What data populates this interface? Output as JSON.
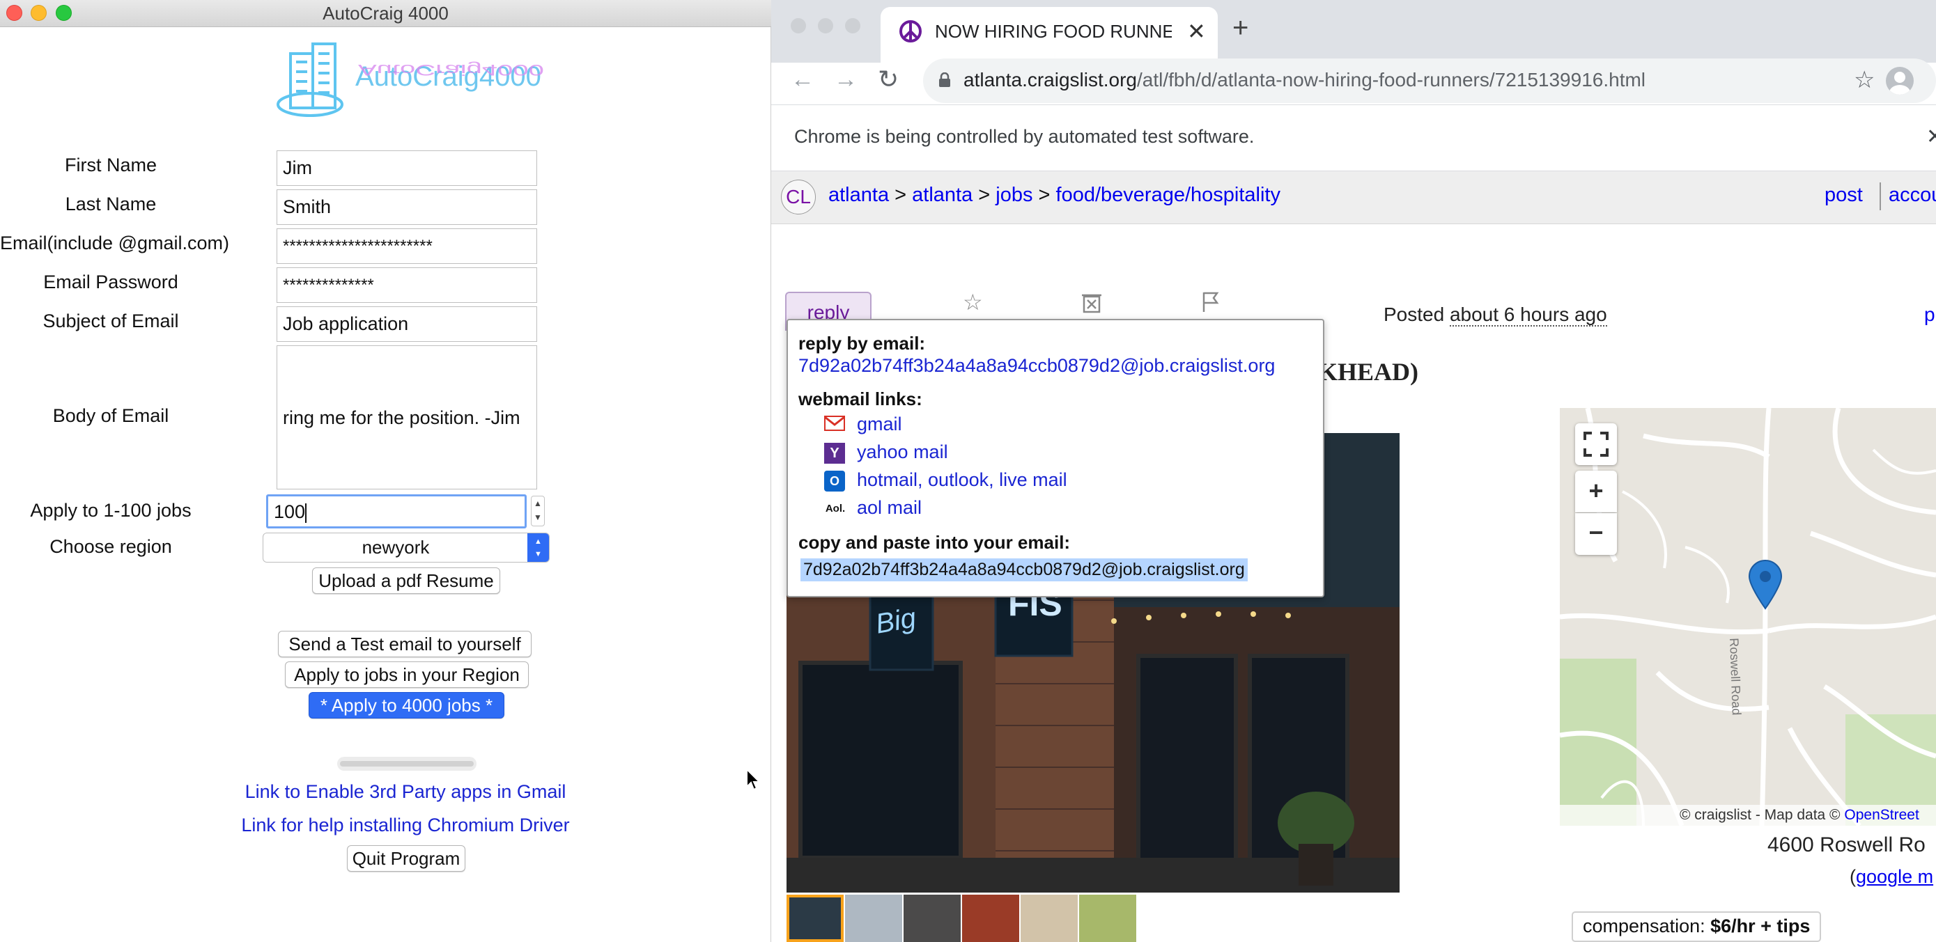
{
  "tk_app": {
    "window_title": "AutoCraig 4000",
    "logo_text": "AutoCraig4000",
    "fields": [
      {
        "label": "First Name",
        "value": "Jim"
      },
      {
        "label": "Last Name",
        "value": "Smith"
      },
      {
        "label": "Email(include @gmail.com)",
        "value": "***********************"
      },
      {
        "label": "Email Password",
        "value": "**************"
      },
      {
        "label": "Subject of Email",
        "value": "Job application"
      },
      {
        "label": "Body of Email",
        "value": "ring me for the position. -Jim"
      }
    ],
    "apply_count_label": "Apply to 1-100 jobs",
    "apply_count_value": "100",
    "region_label": "Choose region",
    "region_value": "newyork",
    "upload_button": "Upload a pdf Resume",
    "test_email_button": "Send a Test email to yourself",
    "apply_region_button": "Apply to jobs in your Region",
    "apply_all_button": "* Apply to 4000 jobs *",
    "progress": 0,
    "link_gmail": "Link to Enable 3rd Party apps in Gmail",
    "link_chromium": "Link for help installing Chromium Driver",
    "quit_button": "Quit Program"
  },
  "browser": {
    "tab_title": "NOW HIRING FOOD RUNNERS",
    "url_domain": "atlanta.craigslist.org",
    "url_path": "/atl/fbh/d/atlanta-now-hiring-food-runners/7215139916.html",
    "infobar_text": "Chrome is being controlled by automated test software.",
    "cl_logo": "CL",
    "breadcrumbs": [
      "atlanta",
      "atlanta",
      "jobs",
      "food/beverage/hospitality"
    ],
    "breadcrumb_sep": ">",
    "header_post": "post",
    "header_account": "accou",
    "reply_button": "reply",
    "posted_label": "Posted",
    "posted_time": "about 6 hours ago",
    "title_fragment": "KHEAD)",
    "popup": {
      "reply_by_email": "reply by email:",
      "email": "7d92a02b74ff3b24a4a8a94ccb0879d2@job.craigslist.org",
      "webmail_links": "webmail links:",
      "webmail": [
        "gmail",
        "yahoo mail",
        "hotmail, outlook, live mail",
        "aol mail"
      ],
      "copy_paste": "copy and paste into your email:"
    },
    "map_attribution_prefix": "© craigslist - Map data ©",
    "map_attribution_link": "OpenStreet",
    "map_road_label": "Roswell Road",
    "address": "4600 Roswell Ro",
    "google_map_link": "google m",
    "compensation_label": "compensation:",
    "compensation_value": "$6/hr + tips",
    "photo_sign_1": "Big",
    "photo_sign_2": "FIS",
    "colors": {
      "link": "#0000ee",
      "tk_link": "#1a25d2",
      "default_button": "#2f6cf5",
      "selection": "#b5d5ff",
      "map_pin": "#2a7fd4"
    }
  }
}
